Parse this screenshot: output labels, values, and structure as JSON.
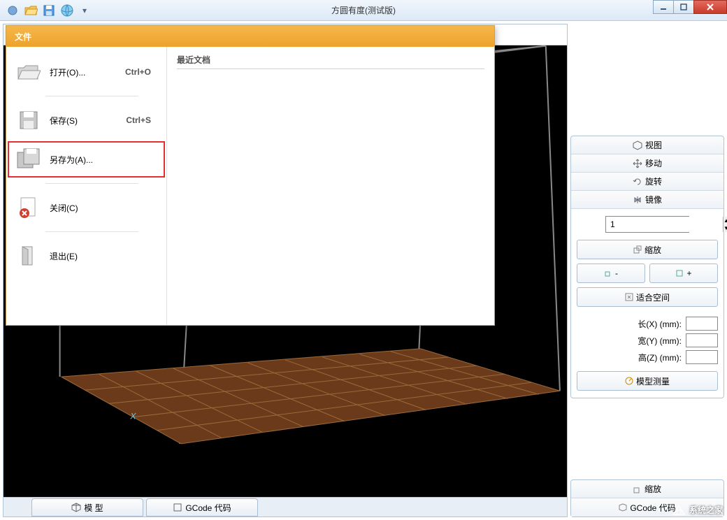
{
  "window": {
    "title": "方圆有度(测试版)"
  },
  "toolbar_icons": [
    "app-icon",
    "open-folder-icon",
    "save-icon",
    "globe-icon"
  ],
  "file_menu": {
    "title": "文件",
    "recent_header": "最近文档",
    "items": [
      {
        "icon": "folder-open",
        "label": "打开(O)...",
        "shortcut": "Ctrl+O"
      },
      {
        "icon": "save",
        "label": "保存(S)",
        "shortcut": "Ctrl+S"
      },
      {
        "icon": "save-as",
        "label": "另存为(A)...",
        "shortcut": "",
        "highlighted": true
      },
      {
        "icon": "close-doc",
        "label": "关闭(C)",
        "shortcut": ""
      },
      {
        "icon": "exit",
        "label": "退出(E)",
        "shortcut": ""
      }
    ]
  },
  "side": {
    "tabs": {
      "view": "视图",
      "move": "移动",
      "rotate": "旋转",
      "mirror": "镜像"
    },
    "scale": {
      "value": "1",
      "scale_btn": "缩放",
      "dec_btn": "-",
      "inc_btn": "+",
      "fit_btn": "适合空间",
      "len_x": "长(X) (mm):",
      "wid_y": "宽(Y) (mm):",
      "hei_z": "高(Z) (mm):",
      "measure_btn": "模型测量"
    },
    "bottom_tabs": {
      "scale": "缩放",
      "gcode": "GCode 代码"
    }
  },
  "bottom_tabs": {
    "model": "模 型",
    "gcode": "GCode 代码"
  },
  "viewport": {
    "axis_label": "X"
  },
  "watermark": "系统之家"
}
